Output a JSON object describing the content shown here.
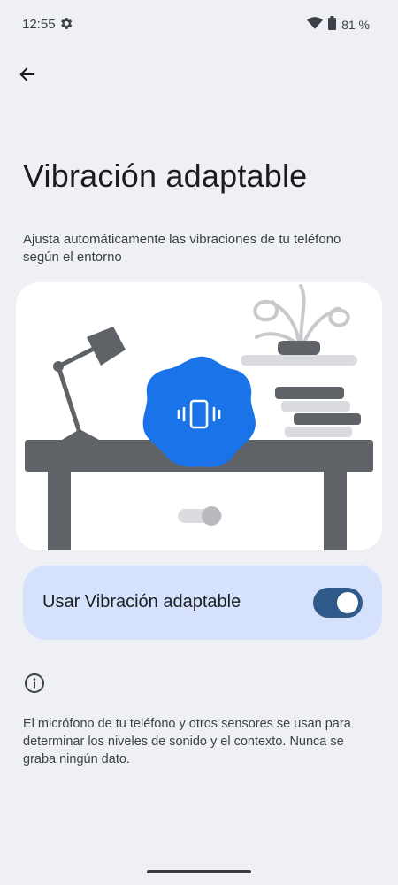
{
  "status_bar": {
    "time": "12:55",
    "battery": "81 %",
    "icons": [
      "gear-icon",
      "wifi-icon",
      "battery-icon"
    ]
  },
  "header": {
    "back_icon": "arrow-left-icon",
    "title": "Vibración adaptable"
  },
  "description": "Ajusta automáticamente las vibraciones de tu teléfono según el entorno",
  "illustration": {
    "badge_icon": "vibrate-phone-icon",
    "accent": "#1a73e8",
    "furniture_color": "#5f6368"
  },
  "toggle": {
    "label": "Usar Vibración adaptable",
    "state": "on",
    "track_color": "#2f5a8a",
    "card_color": "#d6e2fb"
  },
  "info": {
    "icon": "info-icon",
    "text": "El micrófono de tu teléfono y otros sensores se usan para determinar los niveles de sonido y el contexto. Nunca se graba ningún dato."
  }
}
